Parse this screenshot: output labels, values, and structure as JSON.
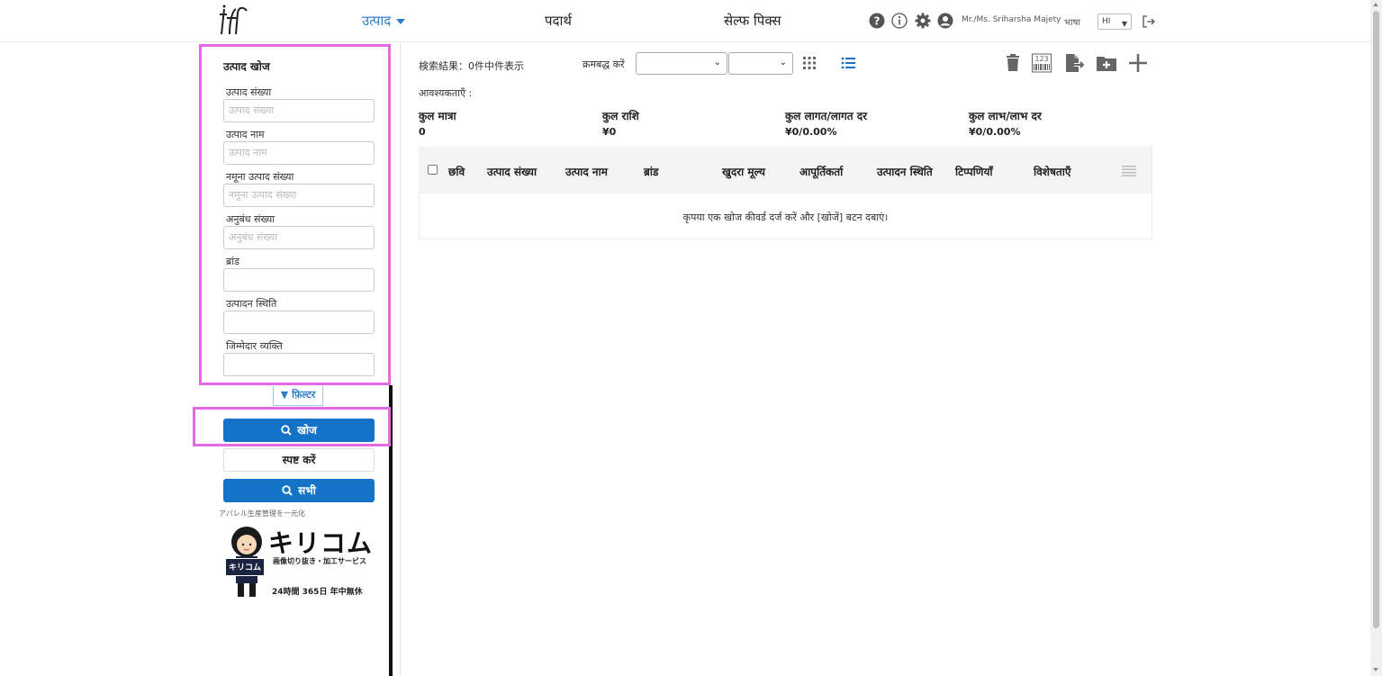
{
  "header": {
    "nav": [
      {
        "label": "उत्पाद",
        "active": true
      },
      {
        "label": "पदार्थ",
        "active": false
      },
      {
        "label": "सेल्फ पिक्स",
        "active": false
      }
    ],
    "icons": [
      "help-icon",
      "info-icon",
      "settings-icon",
      "user-icon",
      "logout-icon"
    ],
    "user_name": "Mr./Ms. Sriharsha Majety",
    "language_label": "भाषा",
    "language_value": "HI"
  },
  "sidebar": {
    "title": "उत्पाद खोज",
    "fields": [
      {
        "label": "उत्पाद संख्या",
        "placeholder": "उत्पाद संख्या"
      },
      {
        "label": "उत्पाद नाम",
        "placeholder": "उत्पाद नाम"
      },
      {
        "label": "नमूना उत्पाद संख्या",
        "placeholder": "नमूना उत्पाद संख्या"
      },
      {
        "label": "अनुबंध संख्या",
        "placeholder": "अनुबंध संख्या"
      },
      {
        "label": "ब्रांड",
        "placeholder": ""
      },
      {
        "label": "उत्पादन स्थिति",
        "placeholder": ""
      },
      {
        "label": "जिम्मेदार व्यक्ति",
        "placeholder": ""
      }
    ],
    "filter_label": "फ़िल्टर",
    "search_label": "खोज",
    "clear_label": "स्पष्ट करें",
    "all_label": "सभी",
    "promo_text": "アパレル生産管理を一元化",
    "promo_banner": {
      "title": "キリコム",
      "subtitle": "画像切り抜き・加工サービス",
      "hours": "24時間 365日 年中無休",
      "badge": "キリコム"
    }
  },
  "main": {
    "results_text": "検索結果：0件中件表示",
    "sort_label": "क्रमबद्ध करें",
    "requirements_label": "आवश्यकताएँ :",
    "summary": [
      {
        "label": "कुल मात्रा",
        "value": "0"
      },
      {
        "label": "कुल राशि",
        "value": "¥0"
      },
      {
        "label": "कुल लागत/लागत दर",
        "value": "¥0/0.00%"
      },
      {
        "label": "कुल लाभ/लाभ दर",
        "value": "¥0/0.00%"
      }
    ],
    "table": {
      "columns": [
        "छवि",
        "उत्पाद संख्या",
        "उत्पाद नाम",
        "ब्रांड",
        "खुदरा मूल्य",
        "आपूर्तिकर्ता",
        "उत्पादन स्थिति",
        "टिप्पणियाँ",
        "विशेषताएँ"
      ],
      "empty_message": "कृपया एक खोज कीवर्ड दर्ज करें और [खोजें] बटन दबाएं।"
    }
  },
  "colors": {
    "accent": "#1473c6",
    "nav_active": "#2d7cc7",
    "highlight": "#e26ae3"
  }
}
